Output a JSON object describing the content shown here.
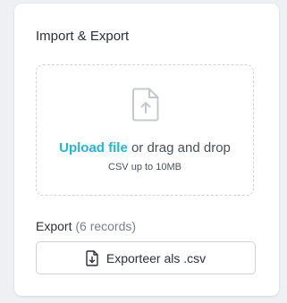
{
  "card": {
    "title": "Import & Export"
  },
  "dropzone": {
    "icon": "file-upload-icon",
    "link_label": "Upload file",
    "text_after_link": " or drag and drop",
    "hint": "CSV up to 10MB"
  },
  "export": {
    "label": "Export",
    "count_text": "(6 records)",
    "button_icon": "file-download-icon",
    "button_label": "Exporteer als .csv"
  },
  "colors": {
    "accent": "#1fb8d1",
    "text": "#2b2f36",
    "muted": "#7a8089",
    "border": "#cfd3d9",
    "background": "#eef0f3",
    "card": "#ffffff"
  }
}
